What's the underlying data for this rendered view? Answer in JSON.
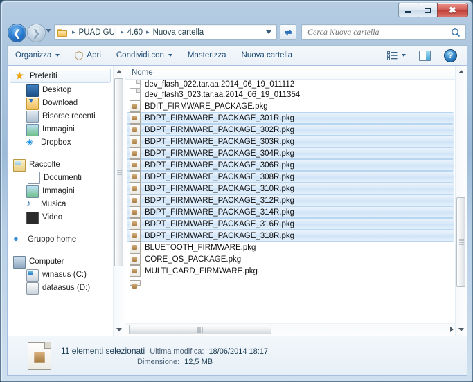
{
  "window": {
    "caption_buttons": [
      {
        "name": "minimize",
        "label": "–"
      },
      {
        "name": "maximize",
        "label": "□"
      },
      {
        "name": "close",
        "label": "✕"
      }
    ]
  },
  "navbar": {
    "back_label": "◀",
    "forward_label": "▶",
    "breadcrumbs": [
      "PUAD GUI",
      "4.60",
      "Nuova cartella"
    ],
    "separator": "▸",
    "search": {
      "placeholder": "Cerca Nuova cartella",
      "value": ""
    }
  },
  "toolbar": {
    "items": [
      {
        "name": "organizza",
        "label": "Organizza",
        "caret": true,
        "icon": null
      },
      {
        "name": "apri",
        "label": "Apri",
        "caret": false,
        "icon": "shield-icon"
      },
      {
        "name": "condividi-con",
        "label": "Condividi con",
        "caret": true,
        "icon": null
      },
      {
        "name": "masterizza",
        "label": "Masterizza",
        "caret": false,
        "icon": null
      },
      {
        "name": "nuova-cartella",
        "label": "Nuova cartella",
        "caret": false,
        "icon": null
      }
    ],
    "help_label": "?"
  },
  "sidebar": {
    "groups": [
      {
        "header": {
          "label": "Preferiti",
          "icon": "star-icon",
          "selected": true
        },
        "items": [
          {
            "label": "Desktop",
            "icon": "desktop-icon"
          },
          {
            "label": "Download",
            "icon": "download-icon"
          },
          {
            "label": "Risorse recenti",
            "icon": "recent-icon"
          },
          {
            "label": "Immagini",
            "icon": "pictures-icon"
          },
          {
            "label": "Dropbox",
            "icon": "dropbox-icon"
          }
        ]
      },
      {
        "header": {
          "label": "Raccolte",
          "icon": "library-icon",
          "selected": false
        },
        "items": [
          {
            "label": "Documenti",
            "icon": "document-icon"
          },
          {
            "label": "Immagini",
            "icon": "pictures-icon"
          },
          {
            "label": "Musica",
            "icon": "music-icon"
          },
          {
            "label": "Video",
            "icon": "video-icon"
          }
        ]
      },
      {
        "header": {
          "label": "Gruppo home",
          "icon": "homegroup-icon",
          "selected": false
        },
        "items": []
      },
      {
        "header": {
          "label": "Computer",
          "icon": "computer-icon",
          "selected": false
        },
        "items": [
          {
            "label": "winasus (C:)",
            "icon": "system-drive-icon"
          },
          {
            "label": "dataasus (D:)",
            "icon": "drive-icon"
          }
        ]
      }
    ]
  },
  "filelist": {
    "column_header": "Nome",
    "rows": [
      {
        "name": "dev_flash_022.tar.aa.2014_06_19_011112",
        "icon": "file-icon",
        "selected": false
      },
      {
        "name": "dev_flash3_023.tar.aa.2014_06_19_011354",
        "icon": "file-icon",
        "selected": false
      },
      {
        "name": "BDIT_FIRMWARE_PACKAGE.pkg",
        "icon": "package-icon",
        "selected": false
      },
      {
        "name": "BDPT_FIRMWARE_PACKAGE_301R.pkg",
        "icon": "package-icon",
        "selected": true
      },
      {
        "name": "BDPT_FIRMWARE_PACKAGE_302R.pkg",
        "icon": "package-icon",
        "selected": true
      },
      {
        "name": "BDPT_FIRMWARE_PACKAGE_303R.pkg",
        "icon": "package-icon",
        "selected": true
      },
      {
        "name": "BDPT_FIRMWARE_PACKAGE_304R.pkg",
        "icon": "package-icon",
        "selected": true
      },
      {
        "name": "BDPT_FIRMWARE_PACKAGE_306R.pkg",
        "icon": "package-icon",
        "selected": true
      },
      {
        "name": "BDPT_FIRMWARE_PACKAGE_308R.pkg",
        "icon": "package-icon",
        "selected": true
      },
      {
        "name": "BDPT_FIRMWARE_PACKAGE_310R.pkg",
        "icon": "package-icon",
        "selected": true
      },
      {
        "name": "BDPT_FIRMWARE_PACKAGE_312R.pkg",
        "icon": "package-icon",
        "selected": true
      },
      {
        "name": "BDPT_FIRMWARE_PACKAGE_314R.pkg",
        "icon": "package-icon",
        "selected": true
      },
      {
        "name": "BDPT_FIRMWARE_PACKAGE_316R.pkg",
        "icon": "package-icon",
        "selected": true
      },
      {
        "name": "BDPT_FIRMWARE_PACKAGE_318R.pkg",
        "icon": "package-icon",
        "selected": true
      },
      {
        "name": "BLUETOOTH_FIRMWARE.pkg",
        "icon": "package-icon",
        "selected": false
      },
      {
        "name": "CORE_OS_PACKAGE.pkg",
        "icon": "package-icon",
        "selected": false
      },
      {
        "name": "MULTI_CARD_FIRMWARE.pkg",
        "icon": "package-icon",
        "selected": false
      }
    ]
  },
  "details": {
    "selection": "11 elementi selezionati",
    "modified_label": "Ultima modifica:",
    "modified_value": "18/06/2014 18:17",
    "size_label": "Dimensione:",
    "size_value": "12,5 MB"
  },
  "colors": {
    "selection_blue": "#cfe3f6",
    "frame_blue": "#a6bee0",
    "close_red": "#bd3c33"
  }
}
